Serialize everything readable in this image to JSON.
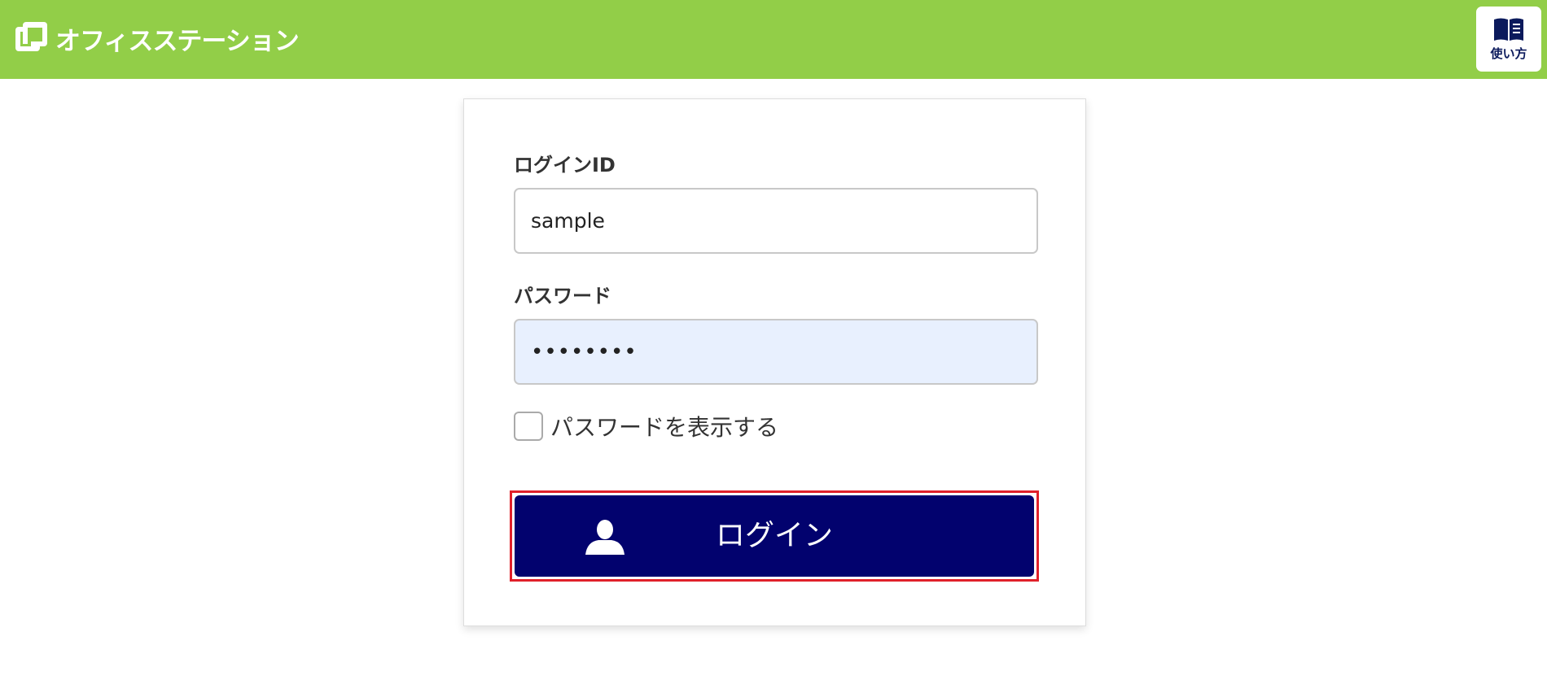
{
  "header": {
    "brand_name": "オフィスステーション",
    "help_label": "使い方",
    "background_color": "#92ce48",
    "logo_icon": "office-station-logo"
  },
  "login_form": {
    "login_id_label": "ログインID",
    "login_id_value": "sample",
    "password_label": "パスワード",
    "password_value": "••••••••",
    "show_password_label": "パスワードを表示する",
    "show_password_checked": false,
    "submit_label": "ログイン",
    "submit_icon": "user-icon",
    "submit_color": "#02026e",
    "highlight_color": "#e0202a"
  }
}
